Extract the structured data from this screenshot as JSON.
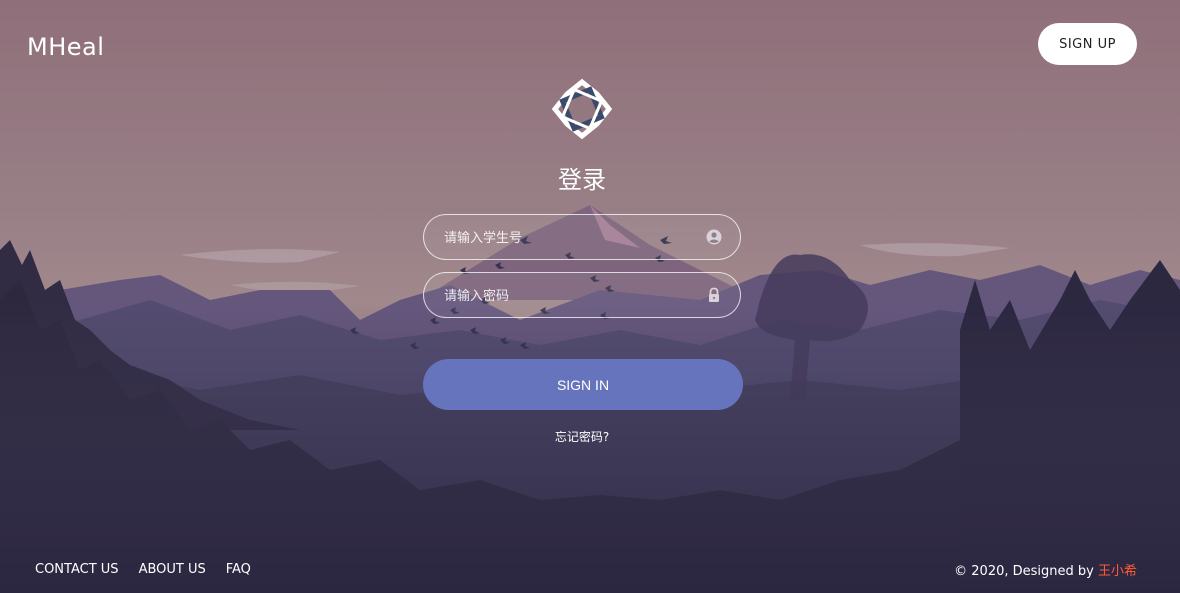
{
  "brand": {
    "name": "MHeal"
  },
  "header": {
    "signup_label": "SIGN UP"
  },
  "login": {
    "title": "登录",
    "student_id": {
      "placeholder": "请输入学生号",
      "value": "",
      "icon": "user-circle-icon"
    },
    "password": {
      "placeholder": "请输入密码",
      "value": "",
      "icon": "lock-icon"
    },
    "signin_label": "SIGN IN",
    "forgot_label": "忘记密码?"
  },
  "footer": {
    "links": [
      "CONTACT US",
      "ABOUT US",
      "FAQ"
    ],
    "copyright_prefix": "© 2020, Designed by",
    "author": "王小希"
  },
  "colors": {
    "accent": "#6674bd",
    "author": "#ff5a36",
    "sky": "#a07f86"
  }
}
